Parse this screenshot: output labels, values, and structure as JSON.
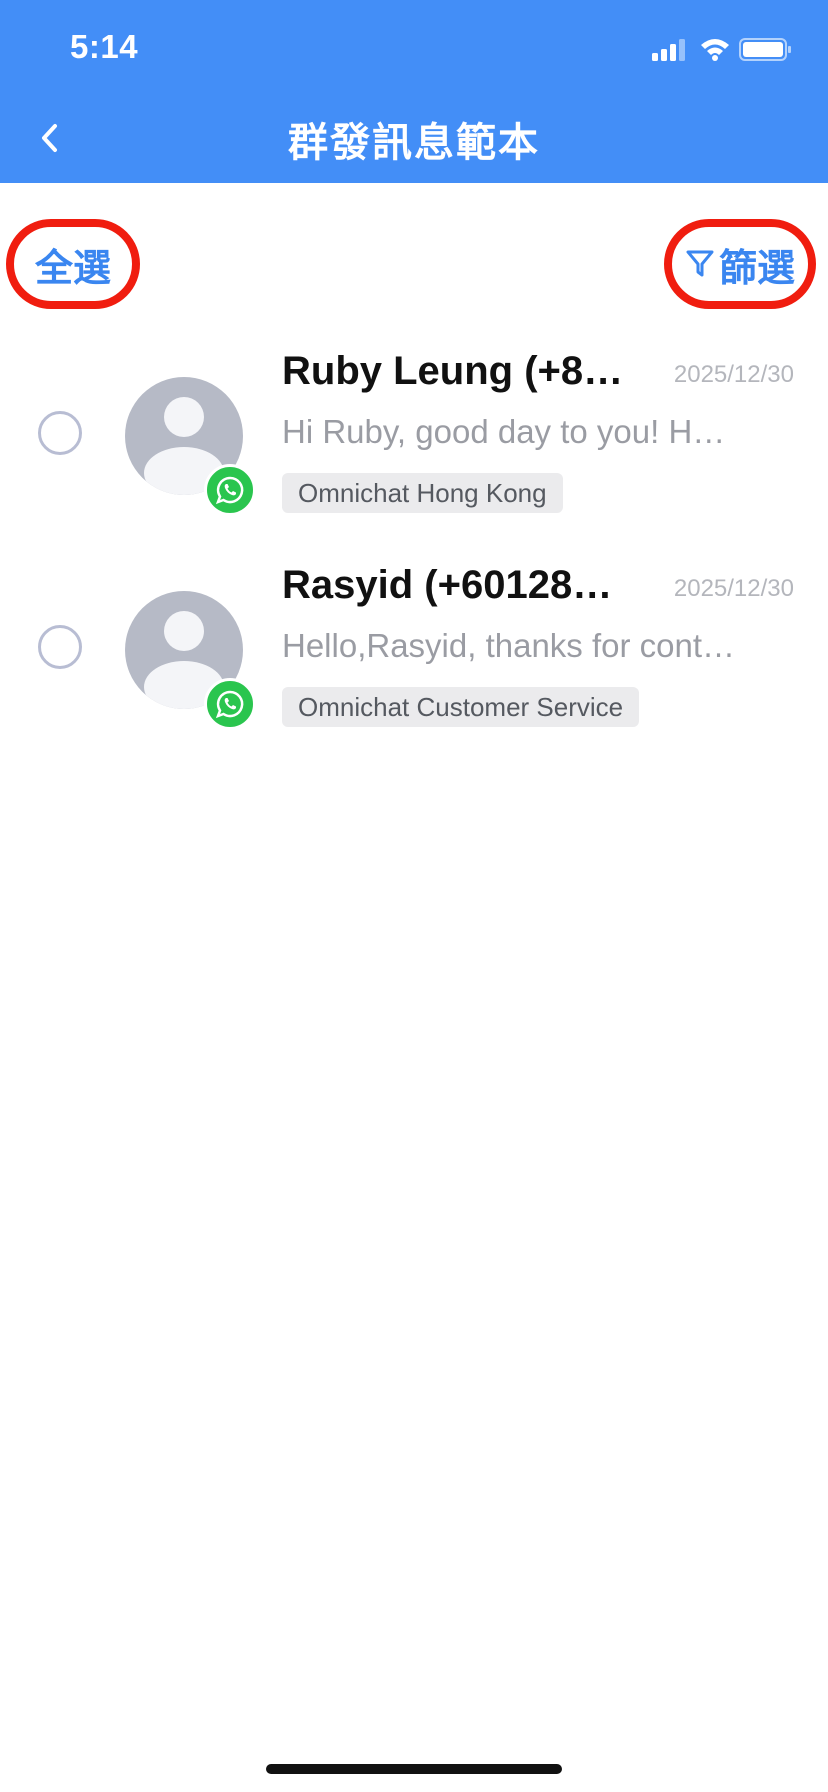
{
  "status_bar": {
    "time": "5:14"
  },
  "nav": {
    "title": "群發訊息範本",
    "back_icon": "chevron-left-icon"
  },
  "actions": {
    "select_all_label": "全選",
    "filter_label": "篩選",
    "filter_icon": "filter-icon"
  },
  "contacts": [
    {
      "name": "Ruby Leung (+8…",
      "date": "2025/12/30",
      "preview": "Hi Ruby, good day to you! H…",
      "tag": "Omnichat Hong Kong",
      "channel_icon": "whatsapp-icon"
    },
    {
      "name": "Rasyid (+60128…",
      "date": "2025/12/30",
      "preview": "Hello,Rasyid, thanks for cont…",
      "tag": "Omnichat Customer Service",
      "channel_icon": "whatsapp-icon"
    }
  ],
  "colors": {
    "header": "#438ef7",
    "accent": "#3a86f0",
    "highlight": "#f01d0f",
    "whatsapp": "#2ac54e"
  }
}
